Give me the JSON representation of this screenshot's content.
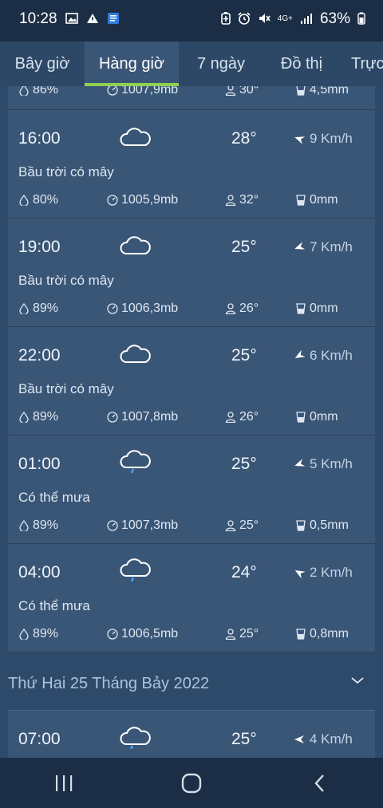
{
  "status_bar": {
    "time": "10:28",
    "network": "4G+",
    "battery": "63%"
  },
  "tabs": [
    {
      "label": "Bây giờ"
    },
    {
      "label": "Hàng giờ",
      "active": true
    },
    {
      "label": "7 ngày"
    },
    {
      "label": "Đồ thị"
    },
    {
      "label": "Trực"
    }
  ],
  "partial_row": {
    "humidity": "86%",
    "pressure": "1007,9mb",
    "feels_like": "30°",
    "rain": "4,5mm"
  },
  "hours": [
    {
      "time": "16:00",
      "icon": "cloud-icon",
      "temp": "28°",
      "wind": "9 Km/h",
      "desc": "Bầu trời có mây",
      "humidity": "80%",
      "pressure": "1005,9mb",
      "feels_like": "32°",
      "rain": "0mm"
    },
    {
      "time": "19:00",
      "icon": "cloud-icon",
      "temp": "25°",
      "wind": "7 Km/h",
      "desc": "Bầu trời có mây",
      "humidity": "89%",
      "pressure": "1006,3mb",
      "feels_like": "26°",
      "rain": "0mm"
    },
    {
      "time": "22:00",
      "icon": "cloud-icon",
      "temp": "25°",
      "wind": "6 Km/h",
      "desc": "Bầu trời có mây",
      "humidity": "89%",
      "pressure": "1007,8mb",
      "feels_like": "26°",
      "rain": "0mm"
    },
    {
      "time": "01:00",
      "icon": "rain-cloud-icon",
      "temp": "25°",
      "wind": "5 Km/h",
      "desc": "Có thể mưa",
      "humidity": "89%",
      "pressure": "1007,3mb",
      "feels_like": "25°",
      "rain": "0,5mm"
    },
    {
      "time": "04:00",
      "icon": "rain-cloud-icon",
      "temp": "24°",
      "wind": "2 Km/h",
      "desc": "Có thể mưa",
      "humidity": "89%",
      "pressure": "1006,5mb",
      "feels_like": "25°",
      "rain": "0,8mm"
    }
  ],
  "day_header": "Thứ Hai 25 Tháng Bảy 2022",
  "next_hour": {
    "time": "07:00",
    "icon": "rain-cloud-icon",
    "temp": "25°",
    "wind": "4 Km/h"
  },
  "colors": {
    "accent": "#8fd14f",
    "card": "#3a5677",
    "background": "#2e4a6b"
  }
}
